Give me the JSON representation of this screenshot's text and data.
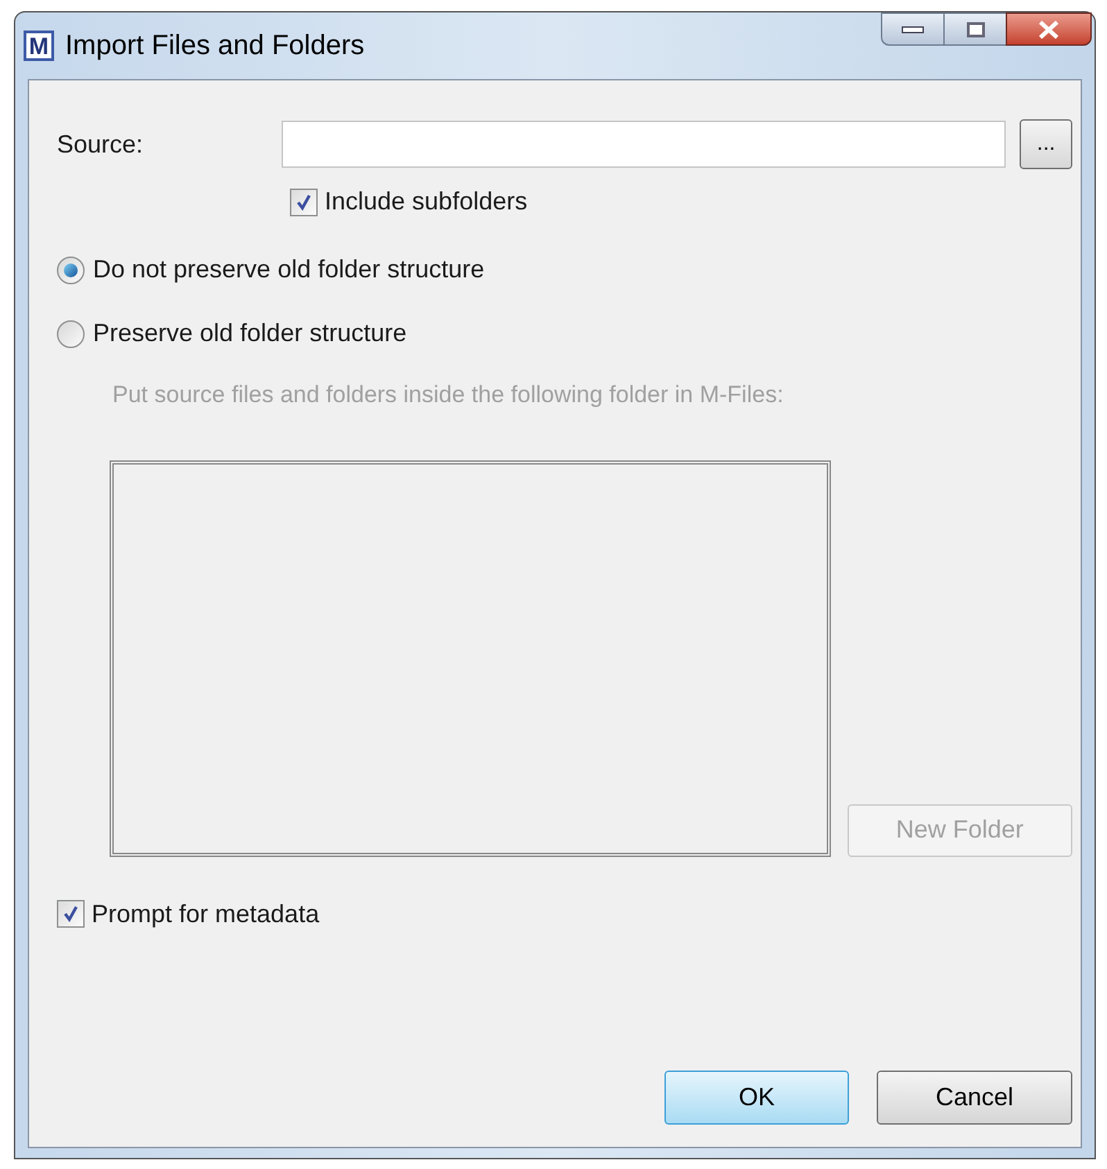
{
  "window": {
    "title": "Import Files and Folders",
    "icon_letter": "M"
  },
  "source": {
    "label": "Source:",
    "browse_button": "..."
  },
  "include_subfolders": {
    "label": "Include subfolders",
    "checked": true
  },
  "structure_options": [
    {
      "label": "Do not preserve old folder structure",
      "selected": true
    },
    {
      "label": "Preserve old folder structure",
      "selected": false
    }
  ],
  "target": {
    "hint": "Put source files and folders inside the following folder in M-Files:",
    "disabled": true,
    "new_folder_button": {
      "label": "New Folder",
      "disabled": true
    }
  },
  "prompt_for_metadata": {
    "label": "Prompt for metadata",
    "checked": true
  },
  "buttons": [
    {
      "label": "OK",
      "kind": "default"
    },
    {
      "label": "Cancel",
      "kind": "normal"
    }
  ]
}
